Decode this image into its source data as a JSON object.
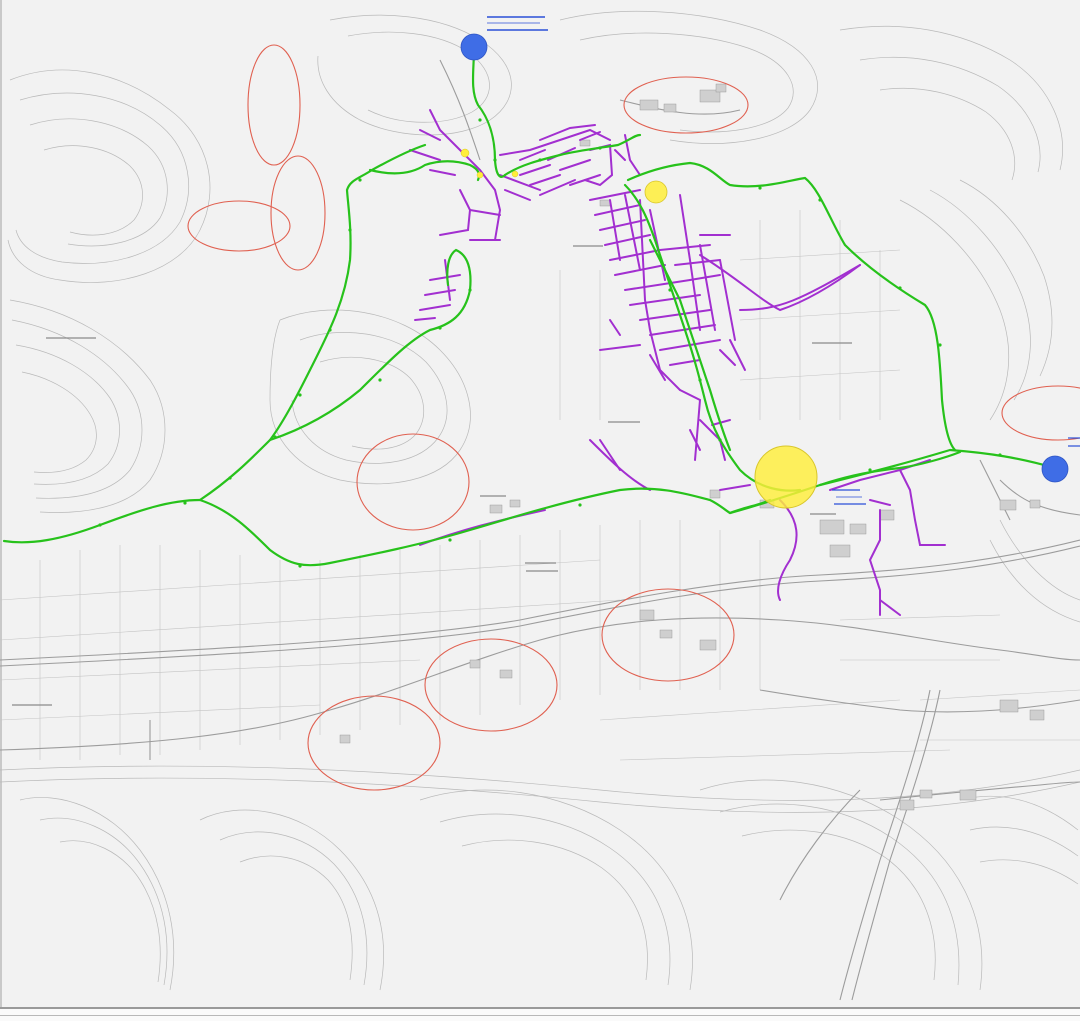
{
  "map": {
    "colors": {
      "background": "#f2f2f2",
      "contour": "#b9b9b9",
      "road": "#9c9c9c",
      "field_line": "#c4c4c4",
      "trunk_main": "#27c21b",
      "distribution_network": "#a22fd0",
      "delivery_point": "#ffee3a",
      "reservoir": "#3f6de6",
      "survey_area": "#e06050"
    },
    "legend_visible": false,
    "place_labels": [],
    "station_labels": []
  }
}
